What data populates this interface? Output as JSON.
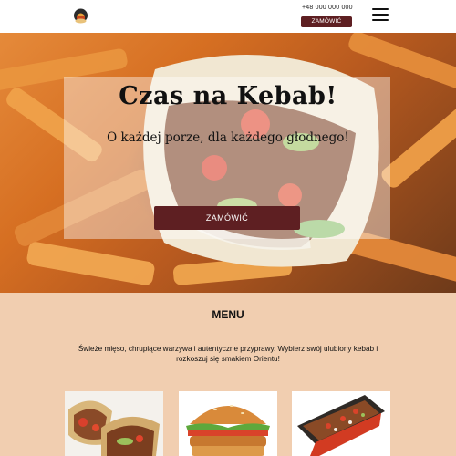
{
  "header": {
    "logo_icon": "kebab-logo-icon",
    "phone": "+48 000 000 000",
    "order_label": "ZAMÓWIĆ",
    "menu_icon": "hamburger-menu-icon"
  },
  "hero": {
    "title": "Czas na Kebab!",
    "subtitle": "O każdej porze, dla każdego głodnego!",
    "button_label": "ZAMÓWIĆ",
    "image": "kebab-wrap-with-fries-photo"
  },
  "menu": {
    "title": "MENU",
    "description": "Świeże mięso, chrupiące warzywa i autentyczne przyprawy. Wybierz swój ulubiony kebab i rozkoszuj się smakiem Orientu!",
    "cards": [
      {
        "image": "kebab-pita-photo"
      },
      {
        "image": "burger-photo"
      },
      {
        "image": "kebab-box-photo"
      }
    ]
  },
  "colors": {
    "accent": "#5e1f22",
    "menu_background": "#f1ceb0"
  }
}
